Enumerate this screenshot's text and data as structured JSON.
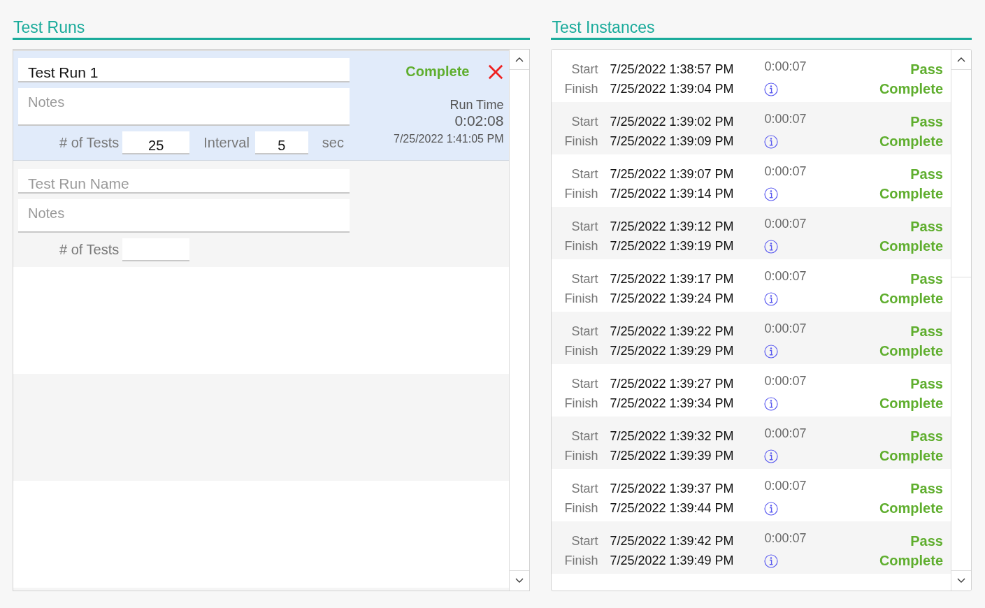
{
  "test_runs": {
    "title": "Test Runs",
    "runs": [
      {
        "name": "Test Run 1",
        "notes_placeholder": "Notes",
        "tests_label": "# of Tests",
        "tests_value": "25",
        "interval_label": "Interval",
        "interval_value": "5",
        "interval_unit": "sec",
        "status": "Complete",
        "run_time_label": "Run Time",
        "run_time": "0:02:08",
        "finished_at": "7/25/2022 1:41:05 PM",
        "selected": true
      }
    ],
    "new_run": {
      "name_placeholder": "Test Run Name",
      "notes_placeholder": "Notes",
      "tests_label": "# of Tests"
    }
  },
  "test_instances": {
    "title": "Test Instances",
    "instances": [
      {
        "start_label": "Start",
        "start": "7/25/2022 1:38:57 PM",
        "finish_label": "Finish",
        "finish": "7/25/2022 1:39:04 PM",
        "duration": "0:00:07",
        "result": "Pass",
        "status": "Complete"
      },
      {
        "start_label": "Start",
        "start": "7/25/2022 1:39:02 PM",
        "finish_label": "Finish",
        "finish": "7/25/2022 1:39:09 PM",
        "duration": "0:00:07",
        "result": "Pass",
        "status": "Complete"
      },
      {
        "start_label": "Start",
        "start": "7/25/2022 1:39:07 PM",
        "finish_label": "Finish",
        "finish": "7/25/2022 1:39:14 PM",
        "duration": "0:00:07",
        "result": "Pass",
        "status": "Complete"
      },
      {
        "start_label": "Start",
        "start": "7/25/2022 1:39:12 PM",
        "finish_label": "Finish",
        "finish": "7/25/2022 1:39:19 PM",
        "duration": "0:00:07",
        "result": "Pass",
        "status": "Complete"
      },
      {
        "start_label": "Start",
        "start": "7/25/2022 1:39:17 PM",
        "finish_label": "Finish",
        "finish": "7/25/2022 1:39:24 PM",
        "duration": "0:00:07",
        "result": "Pass",
        "status": "Complete"
      },
      {
        "start_label": "Start",
        "start": "7/25/2022 1:39:22 PM",
        "finish_label": "Finish",
        "finish": "7/25/2022 1:39:29 PM",
        "duration": "0:00:07",
        "result": "Pass",
        "status": "Complete"
      },
      {
        "start_label": "Start",
        "start": "7/25/2022 1:39:27 PM",
        "finish_label": "Finish",
        "finish": "7/25/2022 1:39:34 PM",
        "duration": "0:00:07",
        "result": "Pass",
        "status": "Complete"
      },
      {
        "start_label": "Start",
        "start": "7/25/2022 1:39:32 PM",
        "finish_label": "Finish",
        "finish": "7/25/2022 1:39:39 PM",
        "duration": "0:00:07",
        "result": "Pass",
        "status": "Complete"
      },
      {
        "start_label": "Start",
        "start": "7/25/2022 1:39:37 PM",
        "finish_label": "Finish",
        "finish": "7/25/2022 1:39:44 PM",
        "duration": "0:00:07",
        "result": "Pass",
        "status": "Complete"
      },
      {
        "start_label": "Start",
        "start": "7/25/2022 1:39:42 PM",
        "finish_label": "Finish",
        "finish": "7/25/2022 1:39:49 PM",
        "duration": "0:00:07",
        "result": "Pass",
        "status": "Complete"
      }
    ]
  }
}
